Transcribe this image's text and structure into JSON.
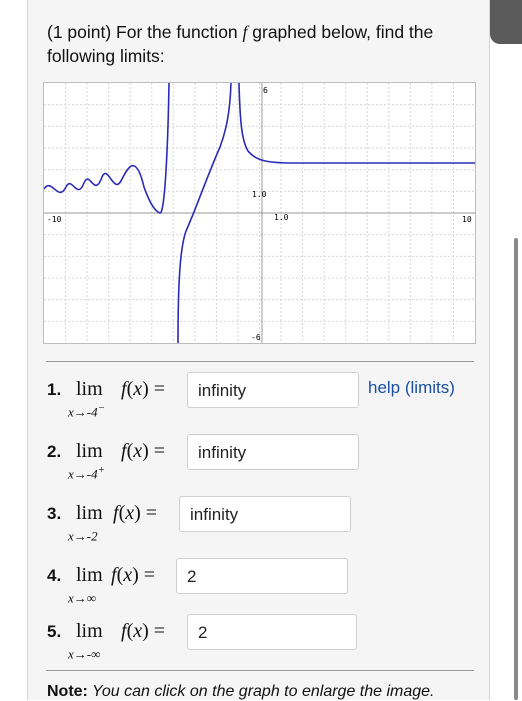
{
  "prompt": {
    "before": "(1 point) For the function ",
    "func": "f",
    "after": " graphed below, find the following limits:"
  },
  "graph": {
    "y_top_label": "6",
    "y_bottom_label": "-6",
    "x_left_label": "-10",
    "x_right_label": "10",
    "tick_label_x": "1.0",
    "tick_label_y": "1.0",
    "curve_color": "#2b2bb8"
  },
  "problems": [
    {
      "num": "1.",
      "lim": "lim",
      "sub_var": "x",
      "sub_arrow": "→",
      "sub_to": "-4",
      "sub_sup": "−",
      "answer": "infinity"
    },
    {
      "num": "2.",
      "lim": "lim",
      "sub_var": "x",
      "sub_arrow": "→",
      "sub_to": "-4",
      "sub_sup": "+",
      "answer": "infinity"
    },
    {
      "num": "3.",
      "lim": "lim",
      "sub_var": "x",
      "sub_arrow": "→",
      "sub_to": "-2",
      "sub_sup": "",
      "answer": "infinity"
    },
    {
      "num": "4.",
      "lim": "lim",
      "sub_var": "x",
      "sub_arrow": "→",
      "sub_to": "∞",
      "sub_sup": "",
      "answer": "2"
    },
    {
      "num": "5.",
      "lim": "lim",
      "sub_var": "x",
      "sub_arrow": "→",
      "sub_to": "-∞",
      "sub_sup": "",
      "answer": "2"
    }
  ],
  "fx": {
    "f": "f",
    "open": "(",
    "x": "x",
    "close": ") ="
  },
  "help_link": "help (limits)",
  "note": {
    "bold": "Note:",
    "text": " You can click on the graph to enlarge the image."
  }
}
